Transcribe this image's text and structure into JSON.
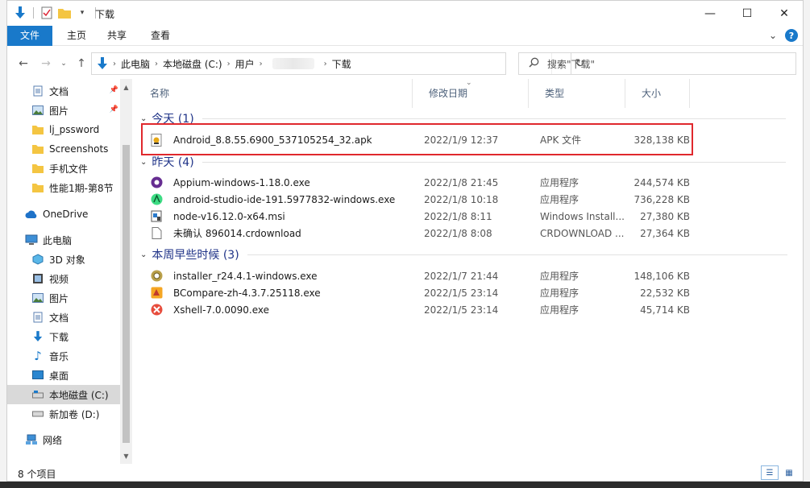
{
  "window": {
    "title": "下载",
    "controls": {
      "minimize": "—",
      "maximize": "☐",
      "close": "✕"
    }
  },
  "ribbon": {
    "tabs": [
      "文件",
      "主页",
      "共享",
      "查看"
    ],
    "expand": "⌄",
    "help": "?"
  },
  "address": {
    "crumbs": [
      "此电脑",
      "本地磁盘 (C:)",
      "用户",
      "下载"
    ],
    "search_placeholder": "搜索\"下载\""
  },
  "nav": {
    "quick": [
      {
        "label": "文档",
        "icon": "documents-icon",
        "pinned": true
      },
      {
        "label": "图片",
        "icon": "pictures-icon",
        "pinned": true
      },
      {
        "label": "lj_pssword",
        "icon": "folder-icon",
        "pinned": false
      },
      {
        "label": "Screenshots",
        "icon": "folder-icon",
        "pinned": false
      },
      {
        "label": "手机文件",
        "icon": "folder-icon",
        "pinned": false
      },
      {
        "label": "性能1期-第8节",
        "icon": "folder-icon",
        "pinned": false
      }
    ],
    "onedrive": "OneDrive",
    "thispc": "此电脑",
    "pc_items": [
      {
        "label": "3D 对象",
        "icon": "3d-objects-icon"
      },
      {
        "label": "视频",
        "icon": "videos-icon"
      },
      {
        "label": "图片",
        "icon": "pictures-icon"
      },
      {
        "label": "文档",
        "icon": "documents-icon"
      },
      {
        "label": "下载",
        "icon": "downloads-icon"
      },
      {
        "label": "音乐",
        "icon": "music-icon"
      },
      {
        "label": "桌面",
        "icon": "desktop-icon"
      },
      {
        "label": "本地磁盘 (C:)",
        "icon": "drive-icon"
      },
      {
        "label": "新加卷 (D:)",
        "icon": "drive-icon"
      }
    ],
    "network": "网络"
  },
  "columns": {
    "name": "名称",
    "date": "修改日期",
    "type": "类型",
    "size": "大小"
  },
  "groups": [
    {
      "title": "今天 (1)",
      "files": [
        {
          "name": "Android_8.8.55.6900_537105254_32.apk",
          "date": "2022/1/9 12:37",
          "type": "APK 文件",
          "size": "328,138 KB",
          "icon": "apk-icon"
        }
      ]
    },
    {
      "title": "昨天 (4)",
      "files": [
        {
          "name": "Appium-windows-1.18.0.exe",
          "date": "2022/1/8 21:45",
          "type": "应用程序",
          "size": "244,574 KB",
          "icon": "appium-icon"
        },
        {
          "name": "android-studio-ide-191.5977832-windows.exe",
          "date": "2022/1/8 10:18",
          "type": "应用程序",
          "size": "736,228 KB",
          "icon": "android-studio-icon"
        },
        {
          "name": "node-v16.12.0-x64.msi",
          "date": "2022/1/8 8:11",
          "type": "Windows Install...",
          "size": "27,380 KB",
          "icon": "msi-icon"
        },
        {
          "name": "未确认 896014.crdownload",
          "date": "2022/1/8 8:08",
          "type": "CRDOWNLOAD ...",
          "size": "27,364 KB",
          "icon": "blank-file-icon"
        }
      ]
    },
    {
      "title": "本周早些时候 (3)",
      "files": [
        {
          "name": "installer_r24.4.1-windows.exe",
          "date": "2022/1/7 21:44",
          "type": "应用程序",
          "size": "148,106 KB",
          "icon": "installer-icon"
        },
        {
          "name": "BCompare-zh-4.3.7.25118.exe",
          "date": "2022/1/5 23:14",
          "type": "应用程序",
          "size": "22,532 KB",
          "icon": "bcompare-icon"
        },
        {
          "name": "Xshell-7.0.0090.exe",
          "date": "2022/1/5 23:14",
          "type": "应用程序",
          "size": "45,714 KB",
          "icon": "xshell-icon"
        }
      ]
    }
  ],
  "status": {
    "count": "8 个项目"
  },
  "colors": {
    "accent": "#1979ca",
    "group_text": "#1e3287",
    "highlight": "#e0282d"
  }
}
